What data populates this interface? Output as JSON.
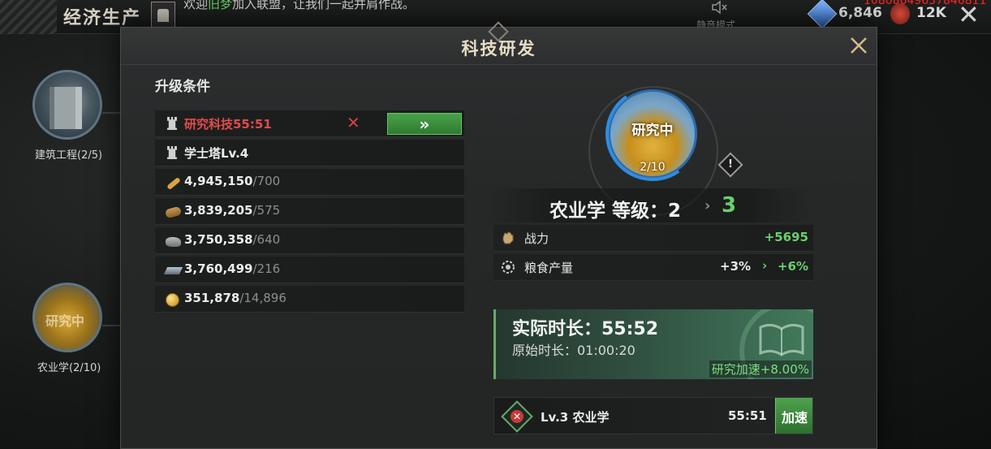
{
  "topbar": {
    "title": "经济生产",
    "chat_prefix": "欢迎",
    "chat_name": "旧梦",
    "chat_suffix": "加入联盟，让我们一起并肩作战。",
    "mute_label": "静音模式",
    "gem_value": "6,846",
    "might_value": "12K",
    "red_id": "10808649637846811"
  },
  "tree": {
    "nodes": [
      {
        "label": "建筑工程(2/5)"
      },
      {
        "label": "农业学(2/10)",
        "status": "研究中"
      }
    ]
  },
  "modal": {
    "title": "科技研发",
    "conditions_title": "升级条件",
    "conditions": [
      {
        "icon": "tower-icon",
        "text": "研究科技55:51",
        "req": "",
        "status": "unmet"
      },
      {
        "icon": "tower-icon",
        "text": "学士塔Lv.4",
        "req": "",
        "status": "met"
      },
      {
        "icon": "food-icon",
        "text": "4,945,150",
        "req": "/700",
        "status": "met"
      },
      {
        "icon": "wood-icon",
        "text": "3,839,205",
        "req": "/575",
        "status": "met"
      },
      {
        "icon": "stone-icon",
        "text": "3,750,358",
        "req": "/640",
        "status": "met"
      },
      {
        "icon": "iron-icon",
        "text": "3,760,499",
        "req": "/216",
        "status": "met"
      },
      {
        "icon": "gold-icon",
        "text": "351,878",
        "req": "/14,896",
        "status": "met"
      }
    ],
    "go_button": "»",
    "tech": {
      "status": "研究中",
      "progress_text": "2/10",
      "progress_fraction": 0.2,
      "name_level": "农业学 等级：2",
      "arrow": "›",
      "next_level": "3"
    },
    "stats": [
      {
        "icon": "power-icon",
        "label": "战力",
        "current": "",
        "value": "+5695"
      },
      {
        "icon": "food-output-icon",
        "label": "粮食产量",
        "current": "+3%",
        "arrow": "›",
        "value": "+6%"
      }
    ],
    "time": {
      "actual": "实际时长：55:52",
      "original": "原始时长：01:00:20",
      "speed": "研究加速+8.00%"
    },
    "queue": {
      "name": "Lv.3 农业学",
      "time": "55:51",
      "button": "加速"
    }
  },
  "colors": {
    "accent_green": "#6ad06a",
    "alert_red": "#e24b4b",
    "progress_blue": "#2f8de0"
  }
}
